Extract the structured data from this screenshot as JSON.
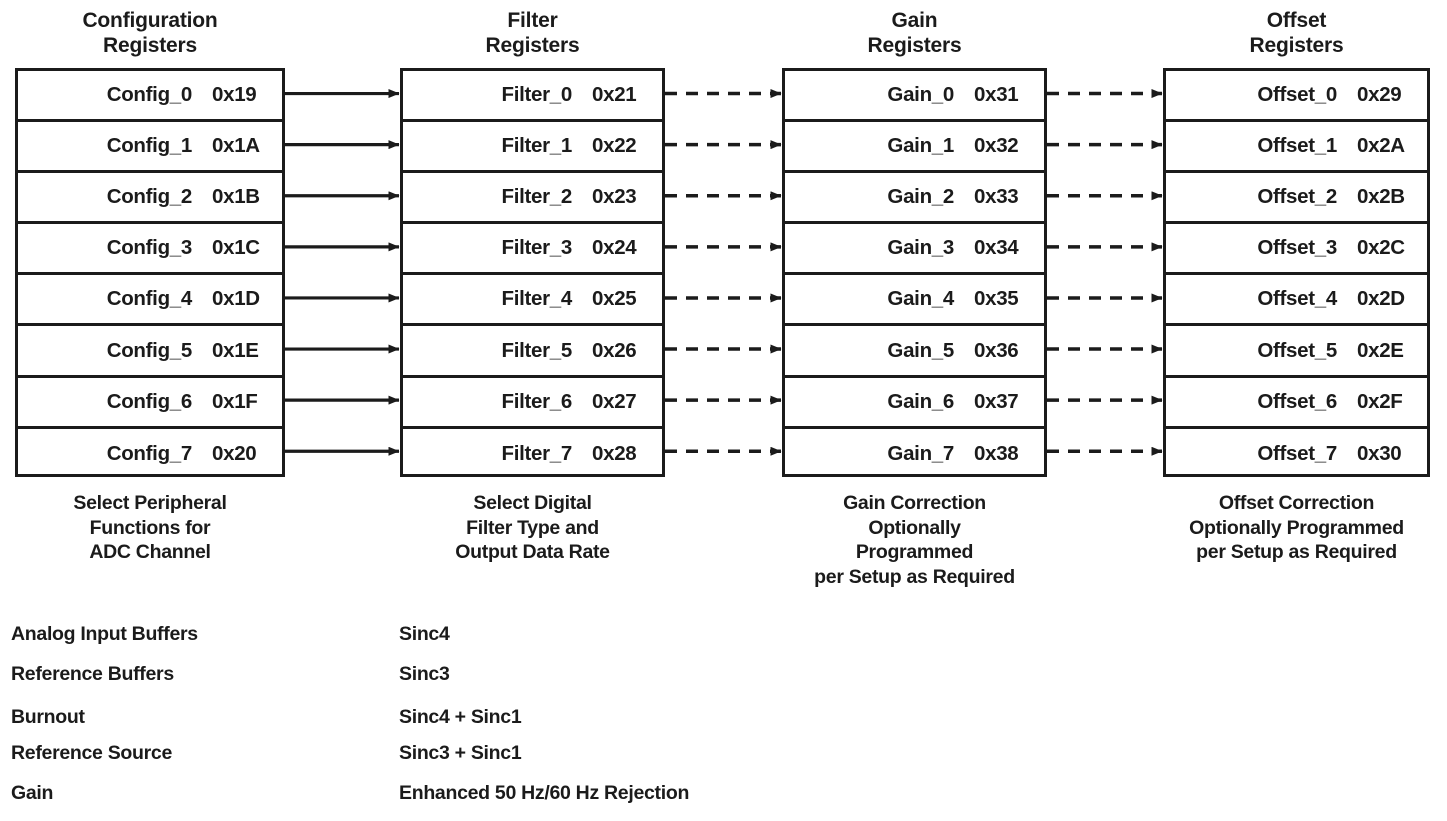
{
  "colors": {
    "line": "#1b1b1b",
    "text": "#1b1b1b",
    "background": "#ffffff"
  },
  "columns": [
    {
      "id": "configuration",
      "title": "Configuration\nRegisters",
      "caption": "Select Peripheral\nFunctions for\nADC Channel",
      "arrow_style": "solid",
      "registers": [
        {
          "name": "Config_0",
          "address": "0x19"
        },
        {
          "name": "Config_1",
          "address": "0x1A"
        },
        {
          "name": "Config_2",
          "address": "0x1B"
        },
        {
          "name": "Config_3",
          "address": "0x1C"
        },
        {
          "name": "Config_4",
          "address": "0x1D"
        },
        {
          "name": "Config_5",
          "address": "0x1E"
        },
        {
          "name": "Config_6",
          "address": "0x1F"
        },
        {
          "name": "Config_7",
          "address": "0x20"
        }
      ]
    },
    {
      "id": "filter",
      "title": "Filter\nRegisters",
      "caption": "Select Digital\nFilter Type and\nOutput Data Rate",
      "arrow_style": "dashed",
      "registers": [
        {
          "name": "Filter_0",
          "address": "0x21"
        },
        {
          "name": "Filter_1",
          "address": "0x22"
        },
        {
          "name": "Filter_2",
          "address": "0x23"
        },
        {
          "name": "Filter_3",
          "address": "0x24"
        },
        {
          "name": "Filter_4",
          "address": "0x25"
        },
        {
          "name": "Filter_5",
          "address": "0x26"
        },
        {
          "name": "Filter_6",
          "address": "0x27"
        },
        {
          "name": "Filter_7",
          "address": "0x28"
        }
      ]
    },
    {
      "id": "gain",
      "title": "Gain\nRegisters",
      "caption": "Gain Correction\nOptionally\nProgrammed\nper Setup as Required",
      "arrow_style": "dashed",
      "registers": [
        {
          "name": "Gain_0",
          "address": "0x31"
        },
        {
          "name": "Gain_1",
          "address": "0x32"
        },
        {
          "name": "Gain_2",
          "address": "0x33"
        },
        {
          "name": "Gain_3",
          "address": "0x34"
        },
        {
          "name": "Gain_4",
          "address": "0x35"
        },
        {
          "name": "Gain_5",
          "address": "0x36"
        },
        {
          "name": "Gain_6",
          "address": "0x37"
        },
        {
          "name": "Gain_7",
          "address": "0x38"
        }
      ]
    },
    {
      "id": "offset",
      "title": "Offset\nRegisters",
      "caption": "Offset Correction\nOptionally Programmed\nper Setup as Required",
      "arrow_style": "none",
      "registers": [
        {
          "name": "Offset_0",
          "address": "0x29"
        },
        {
          "name": "Offset_1",
          "address": "0x2A"
        },
        {
          "name": "Offset_2",
          "address": "0x2B"
        },
        {
          "name": "Offset_3",
          "address": "0x2C"
        },
        {
          "name": "Offset_4",
          "address": "0x2D"
        },
        {
          "name": "Offset_5",
          "address": "0x2E"
        },
        {
          "name": "Offset_6",
          "address": "0x2F"
        },
        {
          "name": "Offset_7",
          "address": "0x30"
        }
      ]
    }
  ],
  "legend": {
    "left_column": [
      "Analog Input Buffers",
      "Reference Buffers",
      "Burnout",
      "Reference Source",
      "Gain"
    ],
    "right_column": [
      "Sinc4",
      "Sinc3",
      "Sinc4 + Sinc1",
      "Sinc3 + Sinc1",
      "Enhanced 50 Hz/60 Hz Rejection"
    ]
  }
}
